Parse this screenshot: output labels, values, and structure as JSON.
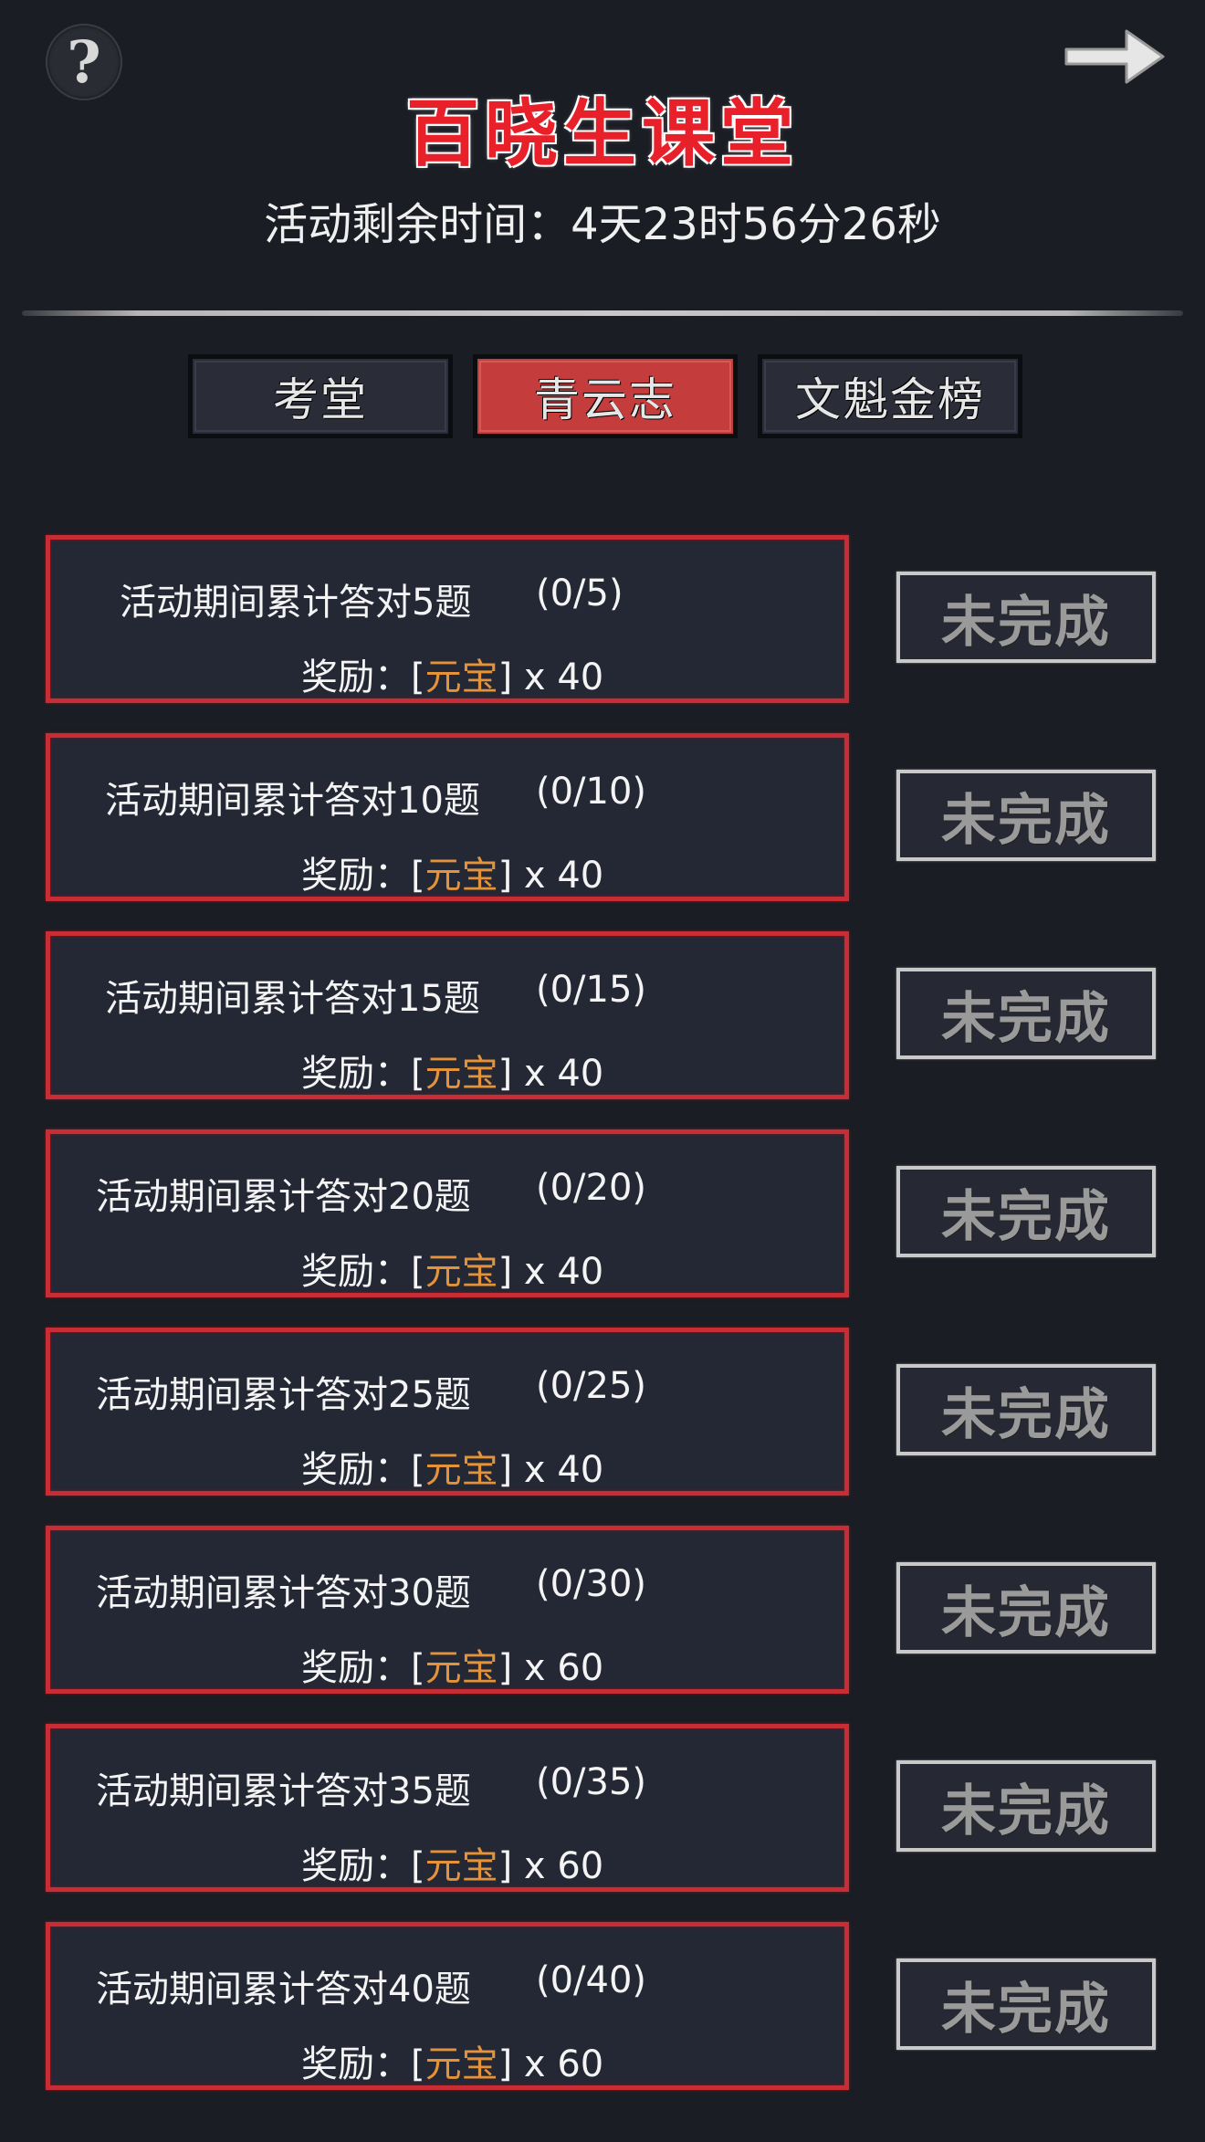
{
  "header": {
    "help_icon_glyph": "?",
    "title": "百晓生课堂",
    "countdown": "活动剩余时间：4天23时56分26秒"
  },
  "tabs": [
    {
      "label": "考堂",
      "active": false
    },
    {
      "label": "青云志",
      "active": true
    },
    {
      "label": "文魁金榜",
      "active": false
    }
  ],
  "tasks": [
    {
      "text": "活动期间累计答对5题",
      "progress": "(0/5)",
      "reward_prefix": "奖励：[",
      "reward_item": "元宝",
      "reward_suffix": "] x 40",
      "status": "未完成"
    },
    {
      "text": "活动期间累计答对10题",
      "progress": "(0/10)",
      "reward_prefix": "奖励：[",
      "reward_item": "元宝",
      "reward_suffix": "] x 40",
      "status": "未完成"
    },
    {
      "text": "活动期间累计答对15题",
      "progress": "(0/15)",
      "reward_prefix": "奖励：[",
      "reward_item": "元宝",
      "reward_suffix": "] x 40",
      "status": "未完成"
    },
    {
      "text": "活动期间累计答对20题",
      "progress": "(0/20)",
      "reward_prefix": "奖励：[",
      "reward_item": "元宝",
      "reward_suffix": "] x 40",
      "status": "未完成"
    },
    {
      "text": "活动期间累计答对25题",
      "progress": "(0/25)",
      "reward_prefix": "奖励：[",
      "reward_item": "元宝",
      "reward_suffix": "] x 40",
      "status": "未完成"
    },
    {
      "text": "活动期间累计答对30题",
      "progress": "(0/30)",
      "reward_prefix": "奖励：[",
      "reward_item": "元宝",
      "reward_suffix": "] x 60",
      "status": "未完成"
    },
    {
      "text": "活动期间累计答对35题",
      "progress": "(0/35)",
      "reward_prefix": "奖励：[",
      "reward_item": "元宝",
      "reward_suffix": "] x 60",
      "status": "未完成"
    },
    {
      "text": "活动期间累计答对40题",
      "progress": "(0/40)",
      "reward_prefix": "奖励：[",
      "reward_item": "元宝",
      "reward_suffix": "] x 60",
      "status": "未完成"
    }
  ],
  "colors": {
    "background": "#1b1d24",
    "accent_red": "#c62d34",
    "title_red": "#e8202a",
    "reward_orange": "#e4933a",
    "active_tab": "#c43c3c"
  },
  "icons": {
    "help": "question-mark-icon",
    "next": "arrow-right-icon"
  }
}
